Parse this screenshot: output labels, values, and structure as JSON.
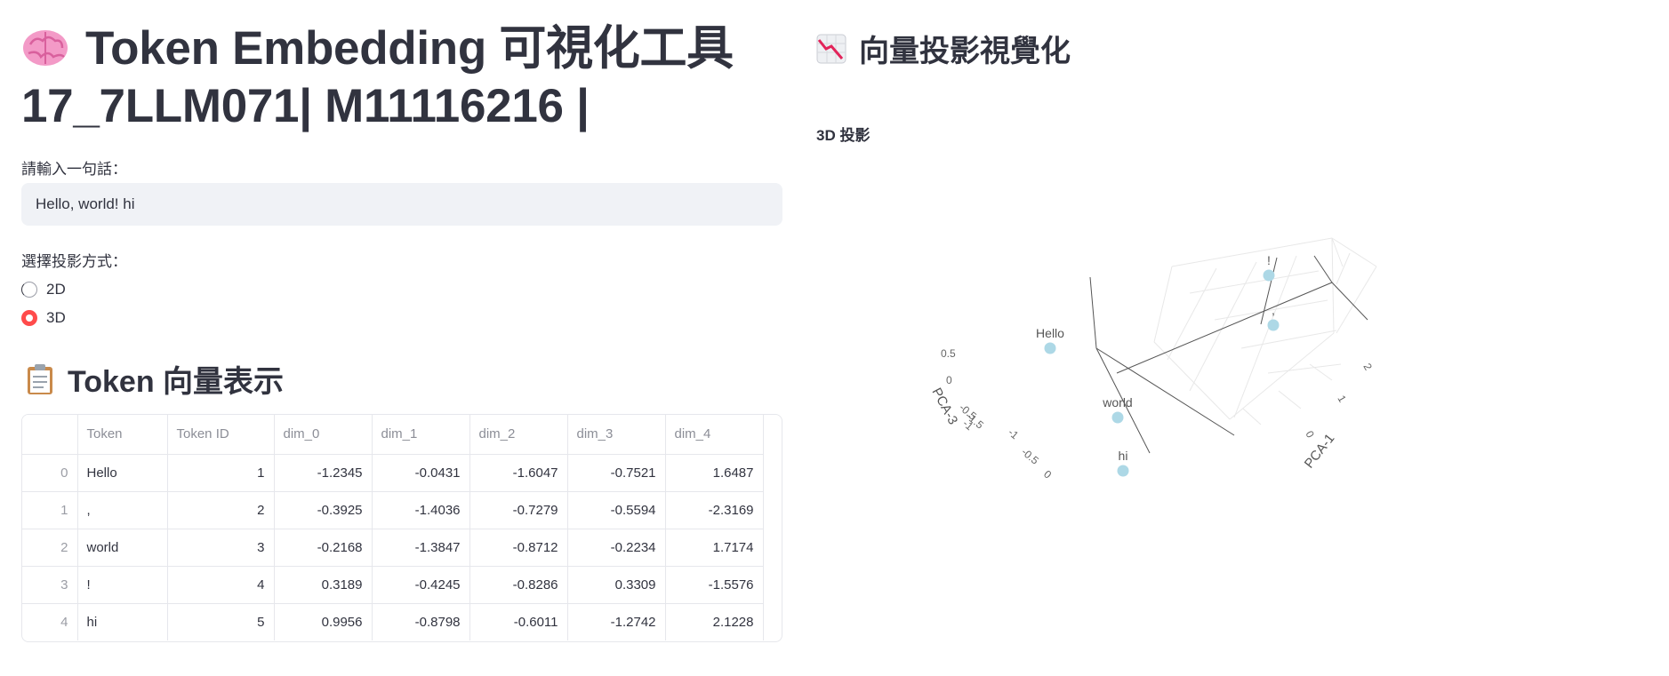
{
  "left": {
    "title_line1": "Token Embedding 可視化工具",
    "title_line2": "17_7LLM071| M11116216 |",
    "input_label": "請輸入一句話：",
    "input_value": "Hello, world! hi",
    "radio_label": "選擇投影方式：",
    "radio_options": [
      "2D",
      "3D"
    ],
    "radio_selected": "3D",
    "table_heading": "Token 向量表示",
    "table": {
      "columns": [
        "",
        "Token",
        "Token ID",
        "dim_0",
        "dim_1",
        "dim_2",
        "dim_3",
        "dim_4"
      ],
      "rows": [
        [
          "0",
          "Hello",
          "1",
          "-1.2345",
          "-0.0431",
          "-1.6047",
          "-0.7521",
          "1.6487"
        ],
        [
          "1",
          ",",
          "2",
          "-0.3925",
          "-1.4036",
          "-0.7279",
          "-0.5594",
          "-2.3169"
        ],
        [
          "2",
          "world",
          "3",
          "-0.2168",
          "-1.3847",
          "-0.8712",
          "-0.2234",
          "1.7174"
        ],
        [
          "3",
          "!",
          "4",
          "0.3189",
          "-0.4245",
          "-0.8286",
          "0.3309",
          "-1.5576"
        ],
        [
          "4",
          "hi",
          "5",
          "0.9956",
          "-0.8798",
          "-0.6011",
          "-1.2742",
          "2.1228"
        ]
      ]
    }
  },
  "right": {
    "heading": "向量投影視覺化",
    "plot_title": "3D 投影",
    "axis_labels": {
      "x": "PCA-1",
      "z": "PCA-3"
    },
    "tick_labels": {
      "z_axis": [
        "0.5",
        "0",
        "-0.5",
        "-1",
        "-1.5"
      ],
      "y_axis_a": [
        "-1",
        "-0.5",
        "0"
      ],
      "x_axis": [
        "2",
        "1",
        "0"
      ]
    },
    "points": [
      {
        "label": "!",
        "color": "#add8e6"
      },
      {
        "label": ",",
        "color": "#add8e6"
      },
      {
        "label": "Hello",
        "color": "#add8e6"
      },
      {
        "label": "world",
        "color": "#add8e6"
      },
      {
        "label": "hi",
        "color": "#add8e6"
      }
    ],
    "chart_data": {
      "type": "scatter",
      "title": "",
      "xlabel": "PCA-1",
      "ylabel": "",
      "zlabel": "PCA-3",
      "series": [
        {
          "values": [
            {
              "label": "Hello",
              "x": 0.0,
              "z": 0.5
            },
            {
              "label": ",",
              "x": 2.0,
              "z": 0.4
            },
            {
              "label": "world",
              "x": -0.3,
              "z": 0.0
            },
            {
              "label": "!",
              "x": 2.0,
              "z": 0.6
            },
            {
              "label": "hi",
              "x": -0.5,
              "z": -0.5
            }
          ]
        }
      ]
    }
  },
  "colors": {
    "accent": "#ff4b4b",
    "marker": "#add8e6",
    "text": "#31333f"
  }
}
